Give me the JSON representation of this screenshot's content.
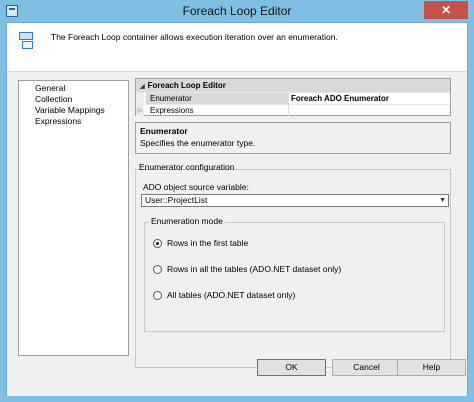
{
  "window": {
    "title": "Foreach Loop Editor",
    "close_glyph": "✕"
  },
  "header": {
    "description": "The Foreach Loop container allows execution iteration over an enumeration."
  },
  "nav": {
    "items": [
      "General",
      "Collection",
      "Variable Mappings",
      "Expressions"
    ]
  },
  "property_grid": {
    "category": "Foreach Loop Editor",
    "rows": [
      {
        "name": "Enumerator",
        "value": "Foreach ADO Enumerator"
      },
      {
        "name": "Expressions",
        "value": ""
      }
    ]
  },
  "description_panel": {
    "title": "Enumerator",
    "text": "Specifies the enumerator type."
  },
  "enumerator_config": {
    "legend": "Enumerator configuration",
    "source_label": "ADO object source variable:",
    "source_value": "User::ProjectList",
    "mode_legend": "Enumeration mode",
    "modes": [
      {
        "label": "Rows in the first table",
        "selected": true
      },
      {
        "label": "Rows in all the tables (ADO.NET dataset only)",
        "selected": false
      },
      {
        "label": "All tables (ADO.NET dataset only)",
        "selected": false
      }
    ]
  },
  "buttons": {
    "ok": "OK",
    "cancel": "Cancel",
    "help": "Help"
  },
  "colors": {
    "titlebar": "#7fbfe3",
    "close_button": "#c7504b",
    "panel_background": "#f0f0f0"
  }
}
